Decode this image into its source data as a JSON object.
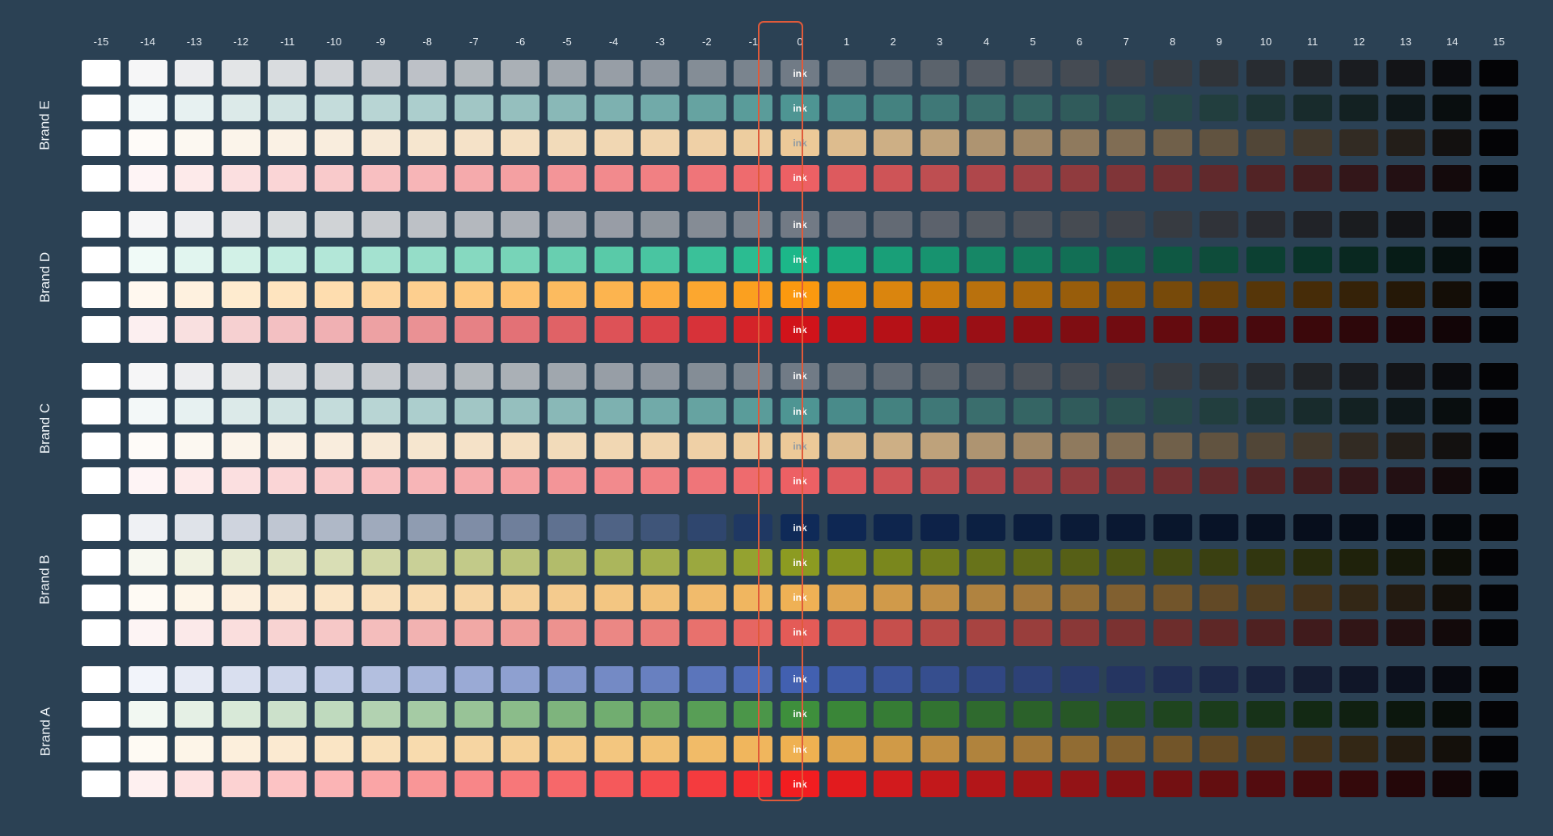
{
  "columns": [
    "-15",
    "-14",
    "-13",
    "-12",
    "-11",
    "-10",
    "-9",
    "-8",
    "-7",
    "-6",
    "-5",
    "-4",
    "-3",
    "-2",
    "-1",
    "0",
    "1",
    "2",
    "3",
    "4",
    "5",
    "6",
    "7",
    "8",
    "9",
    "10",
    "11",
    "12",
    "13",
    "14",
    "15"
  ],
  "swatch_label": "ink",
  "groups": [
    {
      "name": "Brand E",
      "rows": [
        {
          "base": "#717b86",
          "label_color": "#ffffff"
        },
        {
          "base": "#4e9593",
          "label_color": "#ffffff"
        },
        {
          "base": "#ecc998",
          "label_color": "#8f9aa3"
        },
        {
          "base": "#ed6064",
          "label_color": "#ffffff"
        }
      ]
    },
    {
      "name": "Brand D",
      "rows": [
        {
          "base": "#727a85",
          "label_color": "#ffffff"
        },
        {
          "base": "#1cb789",
          "label_color": "#ffffff"
        },
        {
          "base": "#fb990f",
          "label_color": "#ffffff"
        },
        {
          "base": "#d1131a",
          "label_color": "#ffffff"
        }
      ]
    },
    {
      "name": "Brand C",
      "rows": [
        {
          "base": "#717b86",
          "label_color": "#ffffff"
        },
        {
          "base": "#4e9593",
          "label_color": "#ffffff"
        },
        {
          "base": "#ecc998",
          "label_color": "#8f9aa3"
        },
        {
          "base": "#ed6064",
          "label_color": "#ffffff"
        }
      ]
    },
    {
      "name": "Brand B",
      "rows": [
        {
          "base": "#0f2a58",
          "label_color": "#ffffff"
        },
        {
          "base": "#8c9b21",
          "label_color": "#ffffff"
        },
        {
          "base": "#efb155",
          "label_color": "#ffffff"
        },
        {
          "base": "#e45b57",
          "label_color": "#ffffff"
        }
      ]
    },
    {
      "name": "Brand A",
      "rows": [
        {
          "base": "#4260b0",
          "label_color": "#ffffff"
        },
        {
          "base": "#3e8f3c",
          "label_color": "#ffffff"
        },
        {
          "base": "#efb151",
          "label_color": "#ffffff"
        },
        {
          "base": "#f21d20",
          "label_color": "#ffffff"
        }
      ]
    }
  ]
}
